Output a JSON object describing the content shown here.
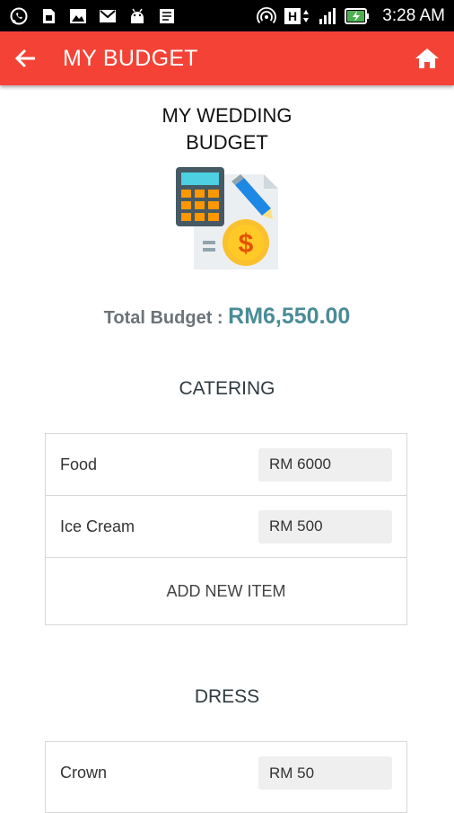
{
  "status_bar": {
    "time": "3:28 AM",
    "network_label": "H",
    "left_icons": [
      "whatsapp-icon",
      "sim-card-icon",
      "image-icon",
      "gmail-icon",
      "android-icon",
      "notes-icon"
    ],
    "right_icons": [
      "hotspot-icon",
      "network-h-icon",
      "signal-icon",
      "battery-charging-icon"
    ]
  },
  "app_bar": {
    "title": "MY BUDGET",
    "background": "#f44336"
  },
  "page": {
    "title_line1": "MY WEDDING",
    "title_line2": "BUDGET",
    "total_label": "Total Budget : ",
    "total_value": "RM6,550.00",
    "accent_color": "#4a8c96"
  },
  "sections": [
    {
      "title": "CATERING",
      "items": [
        {
          "label": "Food",
          "value": "RM 6000"
        },
        {
          "label": "Ice Cream",
          "value": "RM 500"
        }
      ],
      "add_label": "ADD NEW ITEM"
    },
    {
      "title": "DRESS",
      "items": [
        {
          "label": "Crown",
          "value": "RM 50"
        }
      ]
    }
  ]
}
